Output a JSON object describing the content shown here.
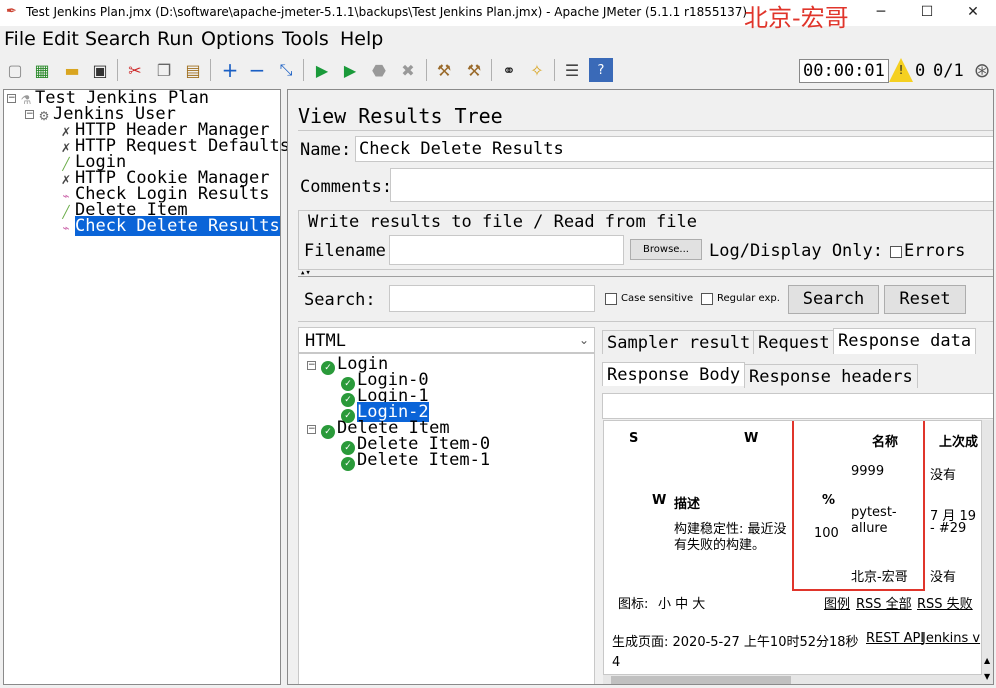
{
  "window": {
    "title": "Test Jenkins Plan.jmx (D:\\software\\apache-jmeter-5.1.1\\backups\\Test Jenkins Plan.jmx) - Apache JMeter (5.1.1 r1855137)",
    "watermark": "北京-宏哥",
    "minimize": "─",
    "maximize": "☐",
    "close": "✕"
  },
  "menu": [
    "File",
    "Edit",
    "Search",
    "Run",
    "Options",
    "Tools",
    "Help"
  ],
  "toolbar": {
    "timer": "00:00:01",
    "warnings": "0",
    "threads": "0/1"
  },
  "tree": {
    "root": "Test Jenkins Plan",
    "thread_group": "Jenkins User",
    "items": [
      "HTTP Header Manager",
      "HTTP Request Defaults",
      "Login",
      "HTTP Cookie Manager",
      "Check Login Results",
      "Delete Item",
      "Check Delete Results"
    ]
  },
  "listener": {
    "title": "View Results Tree",
    "name_label": "Name:",
    "name_value": "Check Delete Results",
    "comments_label": "Comments:",
    "comments_value": "",
    "file_group_title": "Write results to file / Read from file",
    "filename_label": "Filename",
    "filename_value": "",
    "browse_label": "Browse...",
    "log_display_label": "Log/Display Only:",
    "errors_label": "Errors",
    "search_label": "Search:",
    "search_value": "",
    "case_sensitive_label": "Case sensitive",
    "regular_exp_label": "Regular exp.",
    "search_button": "Search",
    "reset_button": "Reset",
    "renderer_value": "HTML"
  },
  "samples": {
    "groups": [
      {
        "label": "Login",
        "children": [
          "Login-0",
          "Login-1",
          "Login-2"
        ]
      },
      {
        "label": "Delete Item",
        "children": [
          "Delete Item-0",
          "Delete Item-1"
        ]
      }
    ],
    "selected": "Login-2"
  },
  "result_tabs": [
    "Sampler result",
    "Request",
    "Response data"
  ],
  "response_tabs": [
    "Response Body",
    "Response headers"
  ],
  "response_html": {
    "col_s": "S",
    "col_w": "W",
    "col_name": "名称",
    "col_last": "上次成",
    "row1_name": "9999",
    "row1_last": "没有",
    "desc_w": "W",
    "desc_label": "描述",
    "percent": "%",
    "desc_text_1": "构建稳定性: 最近没",
    "desc_text_2": "有失败的构建。",
    "health": "100",
    "row2_name_1": "pytest-",
    "row2_name_2": "allure",
    "row2_last_1": "7 月 19",
    "row2_last_2": "- #29",
    "row3_name": "北京-宏哥",
    "row3_last": "没有",
    "icon_label": "图标:",
    "icon_sizes": "小 中 大",
    "legend_link": "图例",
    "rss_all": "RSS 全部",
    "rss_fail": "RSS 失败",
    "generated": "生成页面: 2020-5-27 上午10时52分18秒",
    "rest_api": "REST API",
    "jenkins_ver": "Jenkins v",
    "trailing": "4"
  },
  "colors": {
    "selection": "#0a64d8",
    "highlight_box": "#e0352b",
    "watermark": "#e0352b"
  }
}
